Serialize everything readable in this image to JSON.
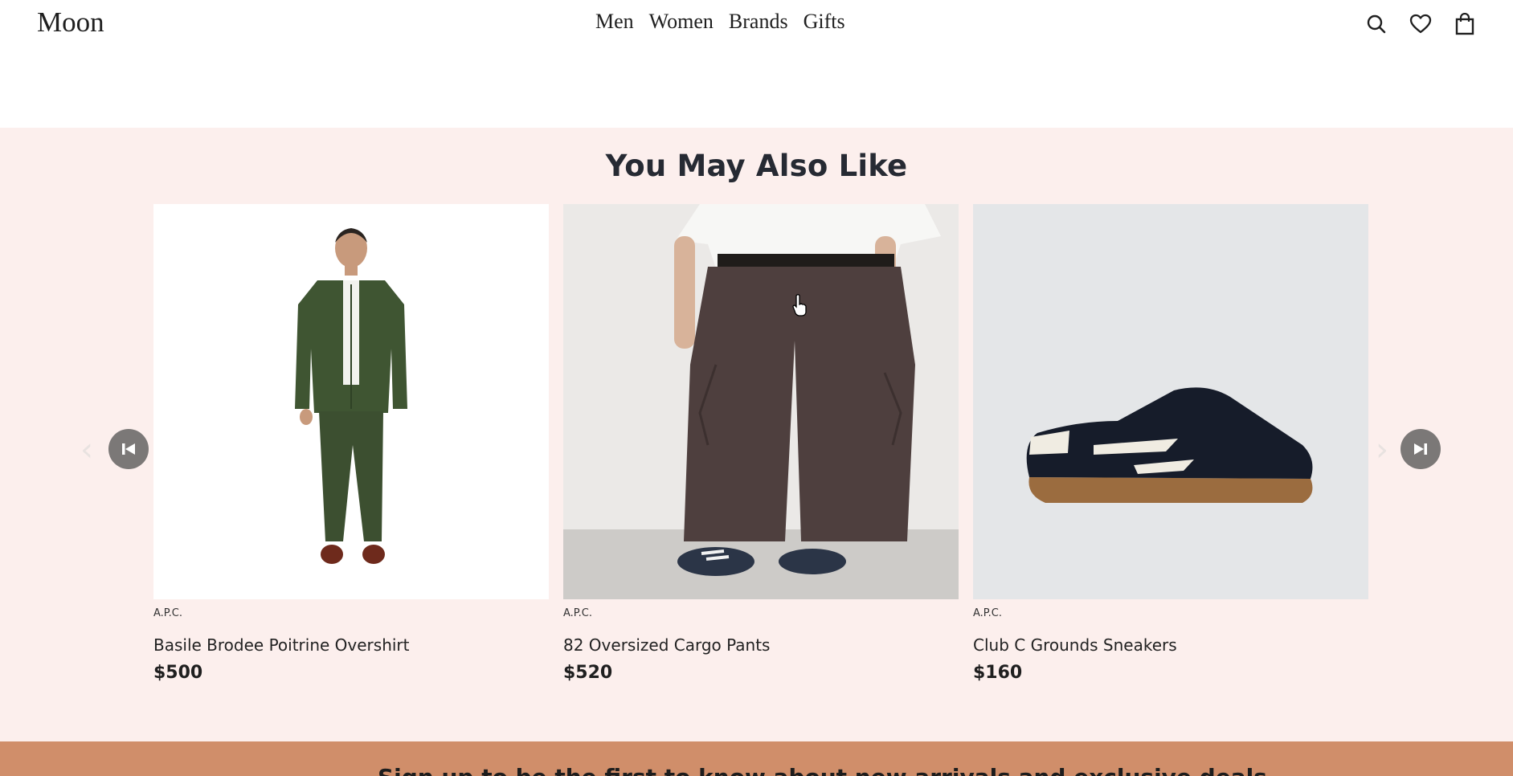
{
  "header": {
    "logo": "Moon",
    "nav": [
      "Men",
      "Women",
      "Brands",
      "Gifts"
    ],
    "icons": [
      "search-icon",
      "heart-icon",
      "bag-icon"
    ]
  },
  "section": {
    "title": "You May Also Like",
    "products": [
      {
        "brand": "A.P.C.",
        "name": "Basile Brodee Poitrine Overshirt",
        "price": "$500"
      },
      {
        "brand": "A.P.C.",
        "name": "82 Oversized Cargo Pants",
        "price": "$520"
      },
      {
        "brand": "A.P.C.",
        "name": "Club C Grounds Sneakers",
        "price": "$160"
      }
    ],
    "carousel": {
      "prev_icon": "skip-previous-icon",
      "next_icon": "skip-next-icon"
    }
  },
  "banner": {
    "text": "Sign up to be the first to know about new arrivals and exclusive deals"
  },
  "colors": {
    "section_bg": "#fcefed",
    "banner_bg": "#d08e6a",
    "arrow_bg": "#7b7877"
  }
}
